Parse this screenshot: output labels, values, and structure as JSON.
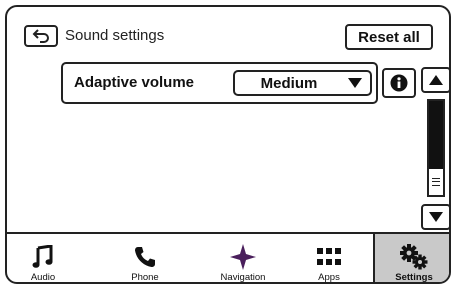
{
  "header": {
    "back_icon": "back-arrow-icon",
    "title": "Sound settings",
    "reset_label": "Reset all"
  },
  "setting": {
    "label": "Adaptive volume",
    "value": "Medium",
    "dropdown_icon": "triangle-down-icon",
    "info_icon": "info-icon"
  },
  "scrollbar": {
    "up_icon": "triangle-up-icon",
    "down_icon": "triangle-down-icon",
    "position": 0
  },
  "nav": {
    "items": [
      {
        "label": "Audio",
        "icon": "music-note-icon",
        "active": false
      },
      {
        "label": "Phone",
        "icon": "phone-icon",
        "active": false
      },
      {
        "label": "Navigation",
        "icon": "compass-star-icon",
        "active": false
      },
      {
        "label": "Apps",
        "icon": "grid-icon",
        "active": false
      },
      {
        "label": "Settings",
        "icon": "gears-icon",
        "active": true
      }
    ]
  },
  "colors": {
    "active_tab_bg": "#c9c9c9",
    "navigation_icon": "#4a1f5c",
    "outline": "#222222"
  }
}
